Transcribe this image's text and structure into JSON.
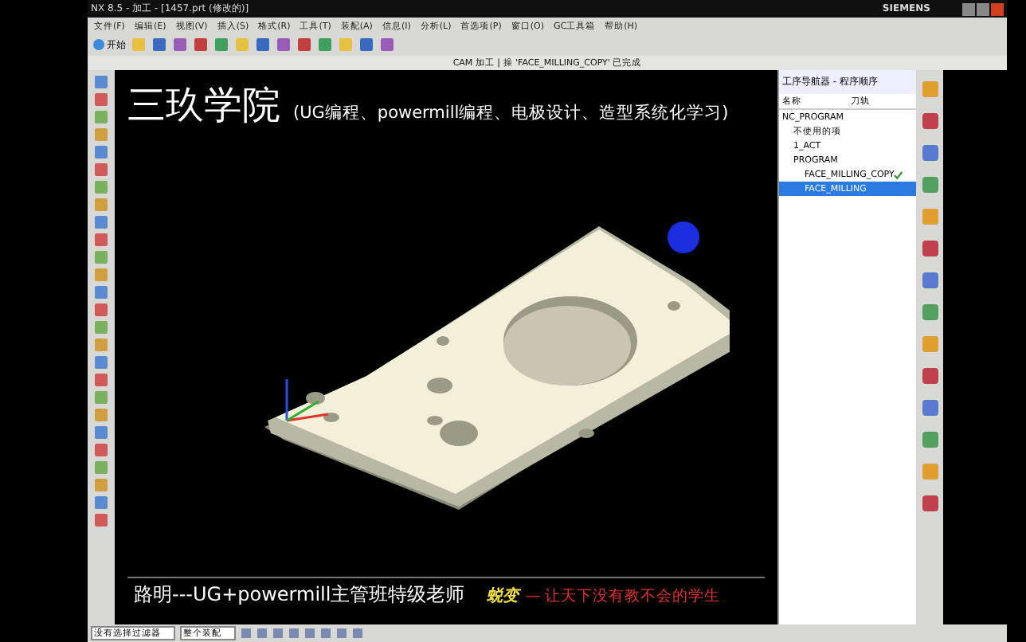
{
  "window": {
    "title": "NX 8.5 - 加工 - [1457.prt (修改的)]",
    "brand": "SIEMENS"
  },
  "menu": [
    "文件(F)",
    "编辑(E)",
    "视图(V)",
    "插入(S)",
    "格式(R)",
    "工具(T)",
    "装配(A)",
    "信息(I)",
    "分析(L)",
    "首选项(P)",
    "窗口(O)",
    "GC工具箱",
    "帮助(H)"
  ],
  "toolbar": {
    "start": "开始"
  },
  "cue_line": "CAM 加工 | 操 'FACE_MILLING_COPY' 已完成",
  "overlay": {
    "title": "三玖学院",
    "subtitle": "(UG编程、powermill编程、电极设计、造型系统化学习)",
    "teacher": "路明---UG+powermill主管班特级老师",
    "signature": "蜕变",
    "slogan": "— 让天下没有教不会的学生"
  },
  "navigator": {
    "title": "工序导航器 - 程序顺序",
    "columns": [
      "名称",
      "刀轨"
    ],
    "items": [
      {
        "name": "NC_PROGRAM",
        "selected": false,
        "done": false,
        "children": [
          {
            "name": "不使用的项",
            "selected": false,
            "done": false
          },
          {
            "name": "1_ACT",
            "selected": false,
            "done": false
          },
          {
            "name": "PROGRAM",
            "selected": false,
            "done": false,
            "children": [
              {
                "name": "FACE_MILLING_COPY",
                "selected": false,
                "done": true
              },
              {
                "name": "FACE_MILLING",
                "selected": true,
                "done": false
              }
            ]
          }
        ]
      }
    ]
  },
  "bottom": {
    "filter": "没有选择过滤器",
    "scope": "整个装配"
  }
}
